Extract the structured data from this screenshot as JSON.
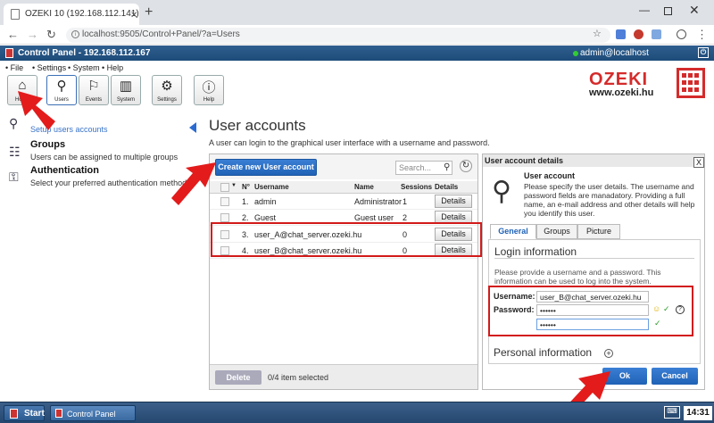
{
  "browser": {
    "tab_title": "OZEKI 10 (192.168.112.141)",
    "url": "localhost:9505/Control+Panel/?a=Users"
  },
  "app": {
    "title": "Control Panel - 192.168.112.167",
    "user": "admin@localhost"
  },
  "menu": [
    "File",
    "Settings",
    "System",
    "Help"
  ],
  "toolbar": [
    {
      "label": "Home",
      "icon": "home-icon"
    },
    {
      "label": "Users",
      "icon": "user-icon"
    },
    {
      "label": "Events",
      "icon": "flag-icon"
    },
    {
      "label": "System",
      "icon": "bars-icon"
    },
    {
      "label": "Settings",
      "icon": "gear-icon"
    },
    {
      "label": "Help",
      "icon": "info-icon"
    }
  ],
  "brand": {
    "name": "OZEKI",
    "url": "www.ozeki.hu"
  },
  "sidebar": {
    "setup_link": "Setup users accounts",
    "groups_title": "Groups",
    "groups_desc": "Users can be assigned to multiple groups",
    "auth_title": "Authentication",
    "auth_desc": "Select your preferred authentication method"
  },
  "page": {
    "title": "User accounts",
    "description": "A user can login to the graphical user interface with a username and password."
  },
  "users": {
    "create_label": "Create new User account",
    "search_placeholder": "Search...",
    "columns": [
      "N°",
      "Username",
      "Name",
      "Sessions",
      "Details"
    ],
    "rows": [
      {
        "num": "1.",
        "username": "admin",
        "name": "Administrator",
        "sessions": "1",
        "details": "Details"
      },
      {
        "num": "2.",
        "username": "Guest",
        "name": "Guest user",
        "sessions": "2",
        "details": "Details"
      },
      {
        "num": "3.",
        "username": "user_A@chat_server.ozeki.hu",
        "name": "",
        "sessions": "0",
        "details": "Details"
      },
      {
        "num": "4.",
        "username": "user_B@chat_server.ozeki.hu",
        "name": "",
        "sessions": "0",
        "details": "Details"
      }
    ],
    "delete_label": "Delete",
    "selected_text": "0/4 item selected"
  },
  "details": {
    "header": "User account details",
    "close": "X",
    "subtitle": "User account",
    "text": "Please specify the user details. The username and password fields are manadatory. Providing a full name, an e-mail address and other details will help you identify this user.",
    "tabs": [
      "General",
      "Groups",
      "Picture"
    ],
    "login_title": "Login information",
    "login_desc": "Please provide a username and a password. This information can be used to log into the system.",
    "username_label": "Username:",
    "username_value": "user_B@chat_server.ozeki.hu",
    "password_label": "Password:",
    "password_value": "••••••",
    "password_confirm": "••••••",
    "personal_title": "Personal information",
    "ok_label": "Ok",
    "cancel_label": "Cancel"
  },
  "taskbar": {
    "start": "Start",
    "item": "Control Panel",
    "clock": "14:31"
  }
}
